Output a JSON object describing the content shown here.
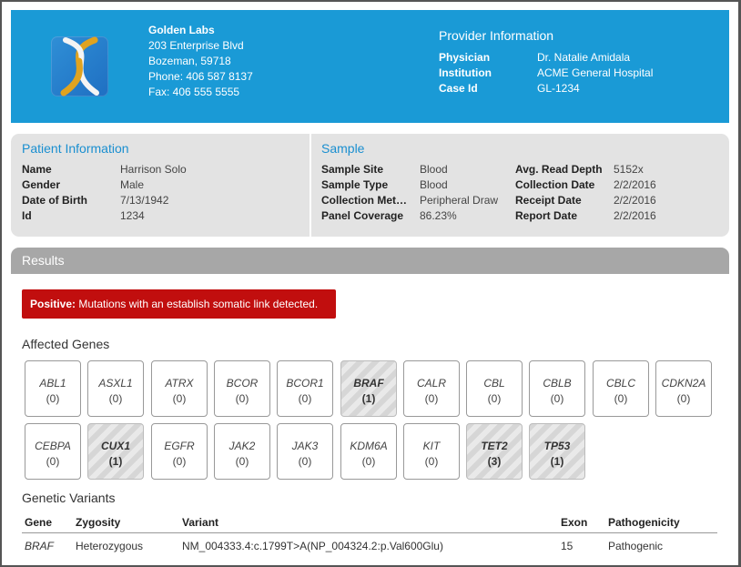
{
  "lab": {
    "name": "Golden Labs",
    "address1": "203 Enterprise Blvd",
    "address2": "Bozeman, 59718",
    "phone": "Phone: 406 587 8137",
    "fax": "Fax: 406 555 5555",
    "logo_icon": "dna-helix-icon"
  },
  "provider": {
    "title": "Provider Information",
    "rows": [
      {
        "k": "Physician",
        "v": "Dr. Natalie Amidala"
      },
      {
        "k": "Institution",
        "v": "ACME General Hospital"
      },
      {
        "k": "Case Id",
        "v": "GL-1234"
      }
    ]
  },
  "patient": {
    "title": "Patient Information",
    "rows": [
      {
        "k": "Name",
        "v": "Harrison Solo"
      },
      {
        "k": "Gender",
        "v": "Male"
      },
      {
        "k": "Date of Birth",
        "v": "7/13/1942"
      },
      {
        "k": "Id",
        "v": "1234"
      }
    ]
  },
  "sample": {
    "title": "Sample",
    "left": [
      {
        "k": "Sample Site",
        "v": "Blood"
      },
      {
        "k": "Sample Type",
        "v": "Blood"
      },
      {
        "k": "Collection Met…",
        "v": "Peripheral Draw"
      },
      {
        "k": "Panel Coverage",
        "v": "86.23%"
      }
    ],
    "right": [
      {
        "k": "Avg. Read Depth",
        "v": "5152x"
      },
      {
        "k": "Collection Date",
        "v": "2/2/2016"
      },
      {
        "k": "Receipt Date",
        "v": "2/2/2016"
      },
      {
        "k": "Report Date",
        "v": "2/2/2016"
      }
    ]
  },
  "results": {
    "title": "Results",
    "alert_bold": "Positive:",
    "alert_text": " Mutations with an establish somatic link detected.",
    "affected_title": "Affected Genes",
    "genes": [
      {
        "name": "ABL1",
        "count": "(0)",
        "hit": false
      },
      {
        "name": "ASXL1",
        "count": "(0)",
        "hit": false
      },
      {
        "name": "ATRX",
        "count": "(0)",
        "hit": false
      },
      {
        "name": "BCOR",
        "count": "(0)",
        "hit": false
      },
      {
        "name": "BCOR1",
        "count": "(0)",
        "hit": false
      },
      {
        "name": "BRAF",
        "count": "(1)",
        "hit": true
      },
      {
        "name": "CALR",
        "count": "(0)",
        "hit": false
      },
      {
        "name": "CBL",
        "count": "(0)",
        "hit": false
      },
      {
        "name": "CBLB",
        "count": "(0)",
        "hit": false
      },
      {
        "name": "CBLC",
        "count": "(0)",
        "hit": false
      },
      {
        "name": "CDKN2A",
        "count": "(0)",
        "hit": false
      },
      {
        "name": "CEBPA",
        "count": "(0)",
        "hit": false
      },
      {
        "name": "CUX1",
        "count": "(1)",
        "hit": true
      },
      {
        "name": "EGFR",
        "count": "(0)",
        "hit": false
      },
      {
        "name": "JAK2",
        "count": "(0)",
        "hit": false
      },
      {
        "name": "JAK3",
        "count": "(0)",
        "hit": false
      },
      {
        "name": "KDM6A",
        "count": "(0)",
        "hit": false
      },
      {
        "name": "KIT",
        "count": "(0)",
        "hit": false
      },
      {
        "name": "TET2",
        "count": "(3)",
        "hit": true
      },
      {
        "name": "TP53",
        "count": "(1)",
        "hit": true
      }
    ],
    "variants_title": "Genetic Variants",
    "variant_headers": [
      "Gene",
      "Zygosity",
      "Variant",
      "Exon",
      "Pathogenicity"
    ],
    "variants": [
      {
        "gene": "BRAF",
        "zygosity": "Heterozygous",
        "variant": "NM_004333.4:c.1799T>A(NP_004324.2:p.Val600Glu)",
        "exon": "15",
        "pathogenicity": "Pathogenic"
      }
    ]
  },
  "colors": {
    "header_blue": "#1a9ad6",
    "alert_red": "#c10e0e",
    "section_blue": "#1a8fd0",
    "helix_gold": "#e0a320"
  }
}
